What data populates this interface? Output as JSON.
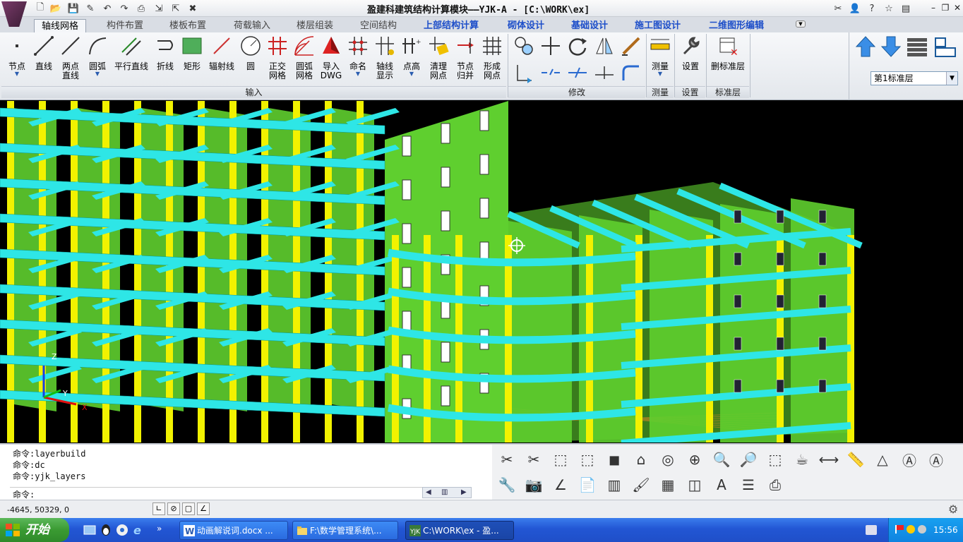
{
  "app": {
    "title": "盈建科建筑结构计算模块——YJK-A - [C:\\WORK\\ex]"
  },
  "tabs": [
    {
      "label": "轴线网格",
      "active": true
    },
    {
      "label": "构件布置"
    },
    {
      "label": "楼板布置"
    },
    {
      "label": "荷载输入"
    },
    {
      "label": "楼层组装"
    },
    {
      "label": "空间结构"
    },
    {
      "label": "上部结构计算"
    },
    {
      "label": "砌体设计"
    },
    {
      "label": "基础设计"
    },
    {
      "label": "施工图设计"
    },
    {
      "label": "二维图形编辑"
    }
  ],
  "ribbon": {
    "input_buttons": [
      {
        "line1": "节点",
        "line2": "",
        "icon": "node-icon"
      },
      {
        "line1": "直线",
        "line2": "",
        "icon": "line-icon"
      },
      {
        "line1": "两点",
        "line2": "直线",
        "icon": "two-point-line-icon"
      },
      {
        "line1": "圆弧",
        "line2": "",
        "icon": "arc-icon"
      },
      {
        "line1": "平行直线",
        "line2": "",
        "icon": "parallel-line-icon"
      },
      {
        "line1": "折线",
        "line2": "",
        "icon": "polyline-icon"
      },
      {
        "line1": "矩形",
        "line2": "",
        "icon": "rectangle-icon"
      },
      {
        "line1": "辐射线",
        "line2": "",
        "icon": "radial-line-icon"
      },
      {
        "line1": "圆",
        "line2": "",
        "icon": "circle-icon"
      },
      {
        "line1": "正交",
        "line2": "网格",
        "icon": "ortho-grid-icon"
      },
      {
        "line1": "圆弧",
        "line2": "网格",
        "icon": "arc-grid-icon"
      },
      {
        "line1": "导入",
        "line2": "DWG",
        "icon": "import-dwg-icon"
      },
      {
        "line1": "命名",
        "line2": "",
        "icon": "name-axis-icon"
      },
      {
        "line1": "轴线",
        "line2": "显示",
        "icon": "axis-display-icon"
      },
      {
        "line1": "点高",
        "line2": "",
        "icon": "point-height-icon"
      },
      {
        "line1": "清理",
        "line2": "网点",
        "icon": "clean-nodes-icon"
      },
      {
        "line1": "节点",
        "line2": "归并",
        "icon": "merge-nodes-icon"
      },
      {
        "line1": "形成",
        "line2": "网点",
        "icon": "form-nodes-icon"
      }
    ],
    "groups": {
      "input": "输入",
      "modify": "修改",
      "measure": "测量",
      "settings": "设置",
      "std_layer": "标准层"
    },
    "measure_label": "测量",
    "settings_label": "设置",
    "delete_std_label": "删标准层",
    "layer_select_value": "第1标准层"
  },
  "command": {
    "history": [
      "命令:layerbuild",
      "命令:dc",
      "命令:yjk_layers"
    ],
    "prompt": "命令:"
  },
  "status": {
    "coords": "-4645, 50329, 0"
  },
  "taskbar": {
    "start_label": "开始",
    "tasks": [
      {
        "label": "动画解说词.docx ...",
        "active": false
      },
      {
        "label": "F:\\数学管理系统\\...",
        "active": false
      },
      {
        "label": "C:\\WORK\\ex - 盈...",
        "active": true
      }
    ],
    "clock": "15:56"
  },
  "viewport": {
    "axis_labels": {
      "z": "Z",
      "y": "Y",
      "x": "X"
    },
    "colors": {
      "column": "#f2f200",
      "beam": "#2ee6e6",
      "wall": "#5fcf2f",
      "grid": "#e01010"
    }
  }
}
